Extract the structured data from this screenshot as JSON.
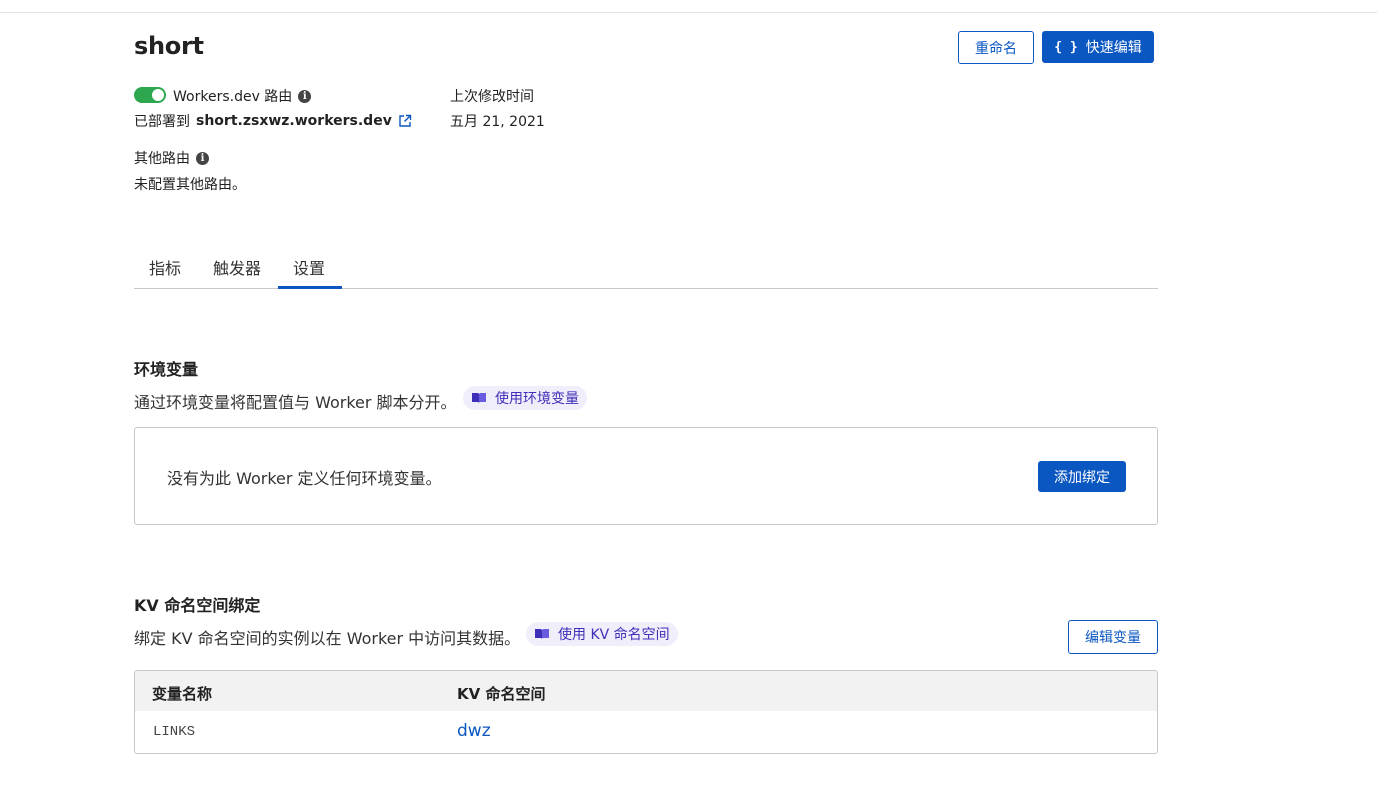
{
  "worker": {
    "name": "short"
  },
  "actions": {
    "rename_label": "重命名",
    "quick_edit_icon": "{ }",
    "quick_edit_label": "快速编辑"
  },
  "routes": {
    "workers_dev_label": "Workers.dev 路由",
    "workers_dev_enabled": true,
    "deployed_prefix": "已部署到",
    "deployed_domain": "short.zsxwz.workers.dev",
    "other_routes_label": "其他路由",
    "other_routes_value": "未配置其他路由。"
  },
  "last_modified": {
    "label": "上次修改时间",
    "value": "五月 21, 2021"
  },
  "tabs": [
    {
      "label": "指标",
      "active": false
    },
    {
      "label": "触发器",
      "active": false
    },
    {
      "label": "设置",
      "active": true
    }
  ],
  "env_vars": {
    "title": "环境变量",
    "description": "通过环境变量将配置值与 Worker 脚本分开。",
    "doc_link": "使用环境变量",
    "empty_message": "没有为此 Worker 定义任何环境变量。",
    "add_button": "添加绑定"
  },
  "kv_bindings": {
    "title": "KV 命名空间绑定",
    "description": "绑定 KV 命名空间的实例以在 Worker 中访问其数据。",
    "doc_link": "使用 KV 命名空间",
    "edit_button": "编辑变量",
    "columns": [
      "变量名称",
      "KV 命名空间"
    ],
    "rows": [
      {
        "variable": "LINKS",
        "namespace": "dwz"
      }
    ]
  },
  "colors": {
    "primary": "#0b57c2",
    "toggle_on": "#2ea84f",
    "doc_pill_bg": "#f0eefb",
    "doc_pill_text": "#3e2fb8"
  },
  "icons": {
    "info": "info-icon",
    "external_link": "external-link-icon",
    "docs": "book-icon",
    "code": "code-braces-icon"
  }
}
